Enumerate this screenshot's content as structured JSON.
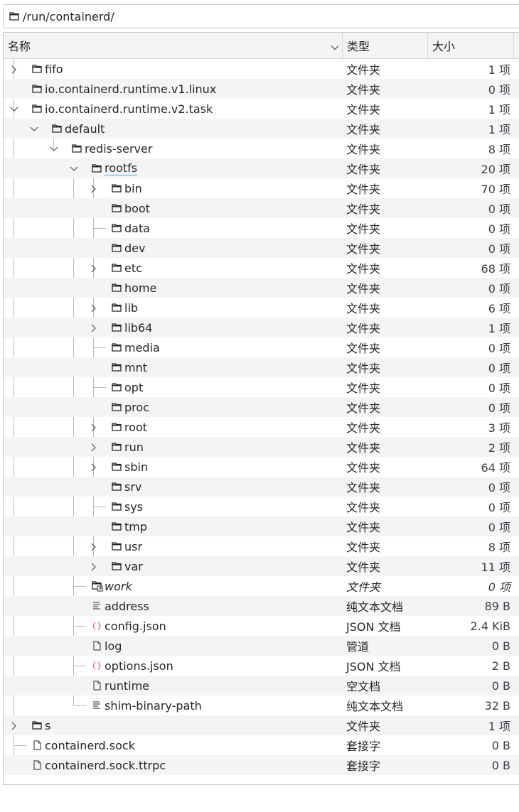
{
  "path_bar": {
    "path": "/run/containerd/"
  },
  "header": {
    "name": "名称",
    "type": "类型",
    "size": "大小"
  },
  "rows": [
    {
      "name": "fifo",
      "type": "文件夹",
      "size": "1 项",
      "depth": 0,
      "icon": "folder-icon",
      "expander": "collapsed"
    },
    {
      "name": "io.containerd.runtime.v1.linux",
      "type": "文件夹",
      "size": "0 项",
      "depth": 0,
      "icon": "folder-icon",
      "expander": "none"
    },
    {
      "name": "io.containerd.runtime.v2.task",
      "type": "文件夹",
      "size": "1 项",
      "depth": 0,
      "icon": "folder-icon",
      "expander": "expanded"
    },
    {
      "name": "default",
      "type": "文件夹",
      "size": "1 项",
      "depth": 1,
      "icon": "folder-icon",
      "expander": "expanded"
    },
    {
      "name": "redis-server",
      "type": "文件夹",
      "size": "8 项",
      "depth": 2,
      "icon": "folder-icon",
      "expander": "expanded"
    },
    {
      "name": "rootfs",
      "type": "文件夹",
      "size": "20 项",
      "depth": 3,
      "icon": "folder-icon",
      "expander": "expanded",
      "current": true
    },
    {
      "name": "bin",
      "type": "文件夹",
      "size": "70 项",
      "depth": 4,
      "icon": "folder-icon",
      "expander": "collapsed"
    },
    {
      "name": "boot",
      "type": "文件夹",
      "size": "0 项",
      "depth": 4,
      "icon": "folder-icon",
      "expander": "none"
    },
    {
      "name": "data",
      "type": "文件夹",
      "size": "0 项",
      "depth": 4,
      "icon": "folder-icon",
      "expander": "none"
    },
    {
      "name": "dev",
      "type": "文件夹",
      "size": "0 项",
      "depth": 4,
      "icon": "folder-icon",
      "expander": "none"
    },
    {
      "name": "etc",
      "type": "文件夹",
      "size": "68 项",
      "depth": 4,
      "icon": "folder-icon",
      "expander": "collapsed"
    },
    {
      "name": "home",
      "type": "文件夹",
      "size": "0 项",
      "depth": 4,
      "icon": "folder-icon",
      "expander": "none"
    },
    {
      "name": "lib",
      "type": "文件夹",
      "size": "6 项",
      "depth": 4,
      "icon": "folder-icon",
      "expander": "collapsed"
    },
    {
      "name": "lib64",
      "type": "文件夹",
      "size": "1 项",
      "depth": 4,
      "icon": "folder-icon",
      "expander": "collapsed"
    },
    {
      "name": "media",
      "type": "文件夹",
      "size": "0 项",
      "depth": 4,
      "icon": "folder-icon",
      "expander": "none"
    },
    {
      "name": "mnt",
      "type": "文件夹",
      "size": "0 项",
      "depth": 4,
      "icon": "folder-icon",
      "expander": "none"
    },
    {
      "name": "opt",
      "type": "文件夹",
      "size": "0 项",
      "depth": 4,
      "icon": "folder-icon",
      "expander": "none"
    },
    {
      "name": "proc",
      "type": "文件夹",
      "size": "0 项",
      "depth": 4,
      "icon": "folder-icon",
      "expander": "none"
    },
    {
      "name": "root",
      "type": "文件夹",
      "size": "3 项",
      "depth": 4,
      "icon": "folder-icon",
      "expander": "collapsed"
    },
    {
      "name": "run",
      "type": "文件夹",
      "size": "2 项",
      "depth": 4,
      "icon": "folder-icon",
      "expander": "collapsed"
    },
    {
      "name": "sbin",
      "type": "文件夹",
      "size": "64 项",
      "depth": 4,
      "icon": "folder-icon",
      "expander": "collapsed"
    },
    {
      "name": "srv",
      "type": "文件夹",
      "size": "0 项",
      "depth": 4,
      "icon": "folder-icon",
      "expander": "none"
    },
    {
      "name": "sys",
      "type": "文件夹",
      "size": "0 项",
      "depth": 4,
      "icon": "folder-icon",
      "expander": "none"
    },
    {
      "name": "tmp",
      "type": "文件夹",
      "size": "0 项",
      "depth": 4,
      "icon": "folder-icon",
      "expander": "none"
    },
    {
      "name": "usr",
      "type": "文件夹",
      "size": "8 项",
      "depth": 4,
      "icon": "folder-icon",
      "expander": "collapsed"
    },
    {
      "name": "var",
      "type": "文件夹",
      "size": "11 项",
      "depth": 4,
      "icon": "folder-icon",
      "expander": "collapsed"
    },
    {
      "name": "work",
      "type": "文件夹",
      "size": "0 项",
      "depth": 3,
      "icon": "folder-link-icon",
      "expander": "none",
      "italic": true
    },
    {
      "name": "address",
      "type": "纯文本文档",
      "size": "89 B",
      "depth": 3,
      "icon": "text-file-icon",
      "expander": "none"
    },
    {
      "name": "config.json",
      "type": "JSON 文档",
      "size": "2.4 KiB",
      "depth": 3,
      "icon": "json-file-icon",
      "expander": "none"
    },
    {
      "name": "log",
      "type": "管道",
      "size": "0 B",
      "depth": 3,
      "icon": "file-icon",
      "expander": "none"
    },
    {
      "name": "options.json",
      "type": "JSON 文档",
      "size": "2 B",
      "depth": 3,
      "icon": "json-file-icon",
      "expander": "none"
    },
    {
      "name": "runtime",
      "type": "空文档",
      "size": "0 B",
      "depth": 3,
      "icon": "file-icon",
      "expander": "none"
    },
    {
      "name": "shim-binary-path",
      "type": "纯文本文档",
      "size": "32 B",
      "depth": 3,
      "icon": "text-file-icon",
      "expander": "none"
    },
    {
      "name": "s",
      "type": "文件夹",
      "size": "1 项",
      "depth": 0,
      "icon": "folder-icon",
      "expander": "collapsed"
    },
    {
      "name": "containerd.sock",
      "type": "套接字",
      "size": "0 B",
      "depth": 0,
      "icon": "file-icon",
      "expander": "none"
    },
    {
      "name": "containerd.sock.ttrpc",
      "type": "套接字",
      "size": "0 B",
      "depth": 0,
      "icon": "file-icon",
      "expander": "none"
    }
  ],
  "colors": {
    "alt_row": "#f3f4f5",
    "border": "#c4c8cc",
    "accent": "#3daee9",
    "json_icon": "#da4453",
    "tree_line": "#b8bbbe"
  }
}
